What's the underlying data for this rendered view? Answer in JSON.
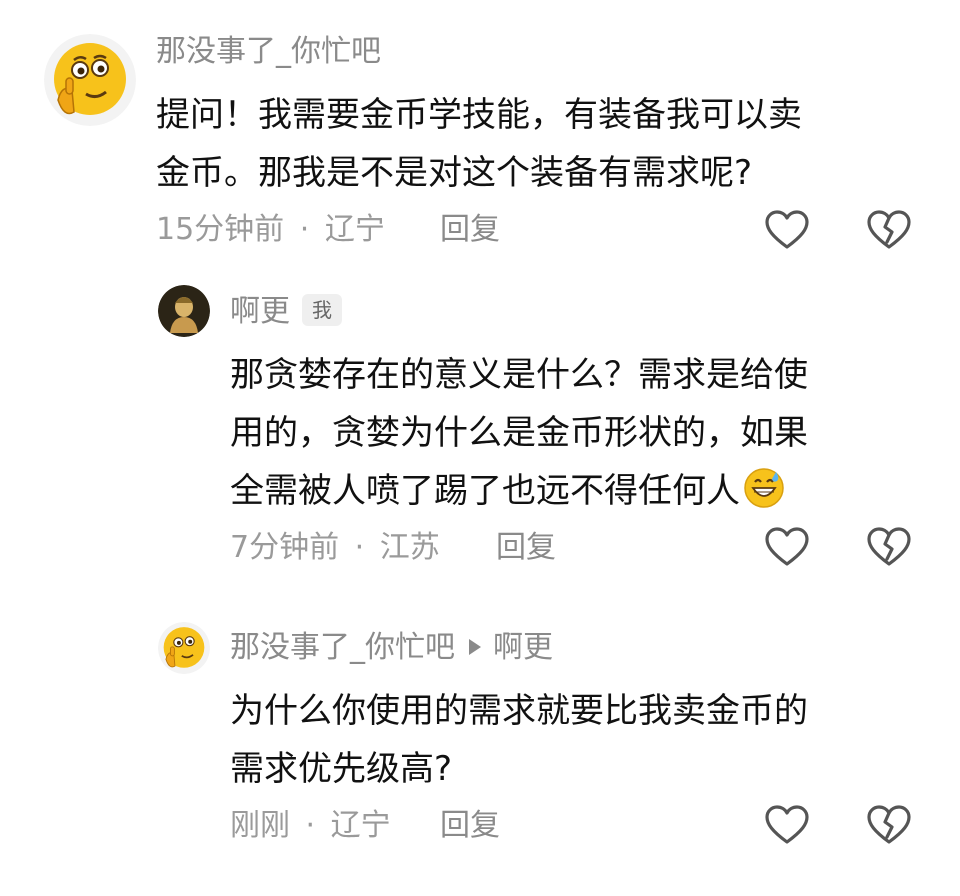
{
  "comments": [
    {
      "author": "那没事了_你忙吧",
      "lines": [
        "提问！我需要金币学技能，有装备我可以卖",
        "金币。那我是不是对这个装备有需求呢?"
      ],
      "time": "15分钟前",
      "location": "辽宁",
      "reply_label": "回复"
    },
    {
      "author": "啊更",
      "badge": "我",
      "lines": [
        "那贪婪存在的意义是什么？需求是给使",
        "用的，贪婪为什么是金币形状的，如果",
        "全需被人喷了踢了也远不得任何人"
      ],
      "time": "7分钟前",
      "location": "江苏",
      "reply_label": "回复"
    },
    {
      "author": "那没事了_你忙吧",
      "reply_to": "啊更",
      "lines": [
        "为什么你使用的需求就要比我卖金币的",
        "需求优先级高?"
      ],
      "time": "刚刚",
      "location": "辽宁",
      "reply_label": "回复"
    }
  ],
  "meta_separator": "·",
  "colors": {
    "meta": "#9a9a9a",
    "name": "#8a8a8a",
    "text": "#111111",
    "emoji_yellow": "#f7c21b"
  },
  "icons": {
    "like": "heart-outline-icon",
    "dislike": "broken-heart-icon",
    "inline_emoji": "grinning-sweat-emoji"
  }
}
